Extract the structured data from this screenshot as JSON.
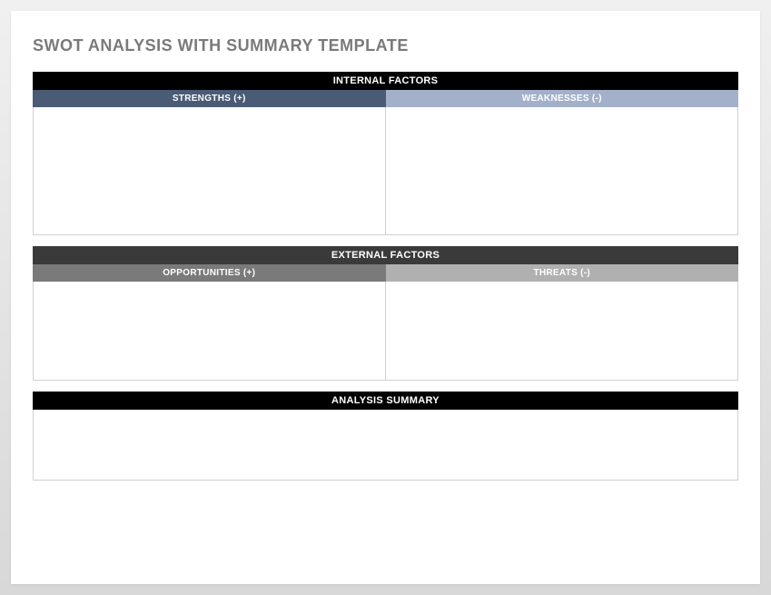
{
  "title": "SWOT ANALYSIS WITH SUMMARY TEMPLATE",
  "internal": {
    "header": "INTERNAL FACTORS",
    "strengths": {
      "label": "STRENGTHS (+)",
      "content": ""
    },
    "weaknesses": {
      "label": "WEAKNESSES (-)",
      "content": ""
    }
  },
  "external": {
    "header": "EXTERNAL FACTORS",
    "opportunities": {
      "label": "OPPORTUNITIES (+)",
      "content": ""
    },
    "threats": {
      "label": "THREATS (-)",
      "content": ""
    }
  },
  "summary": {
    "header": "ANALYSIS SUMMARY",
    "content": ""
  }
}
